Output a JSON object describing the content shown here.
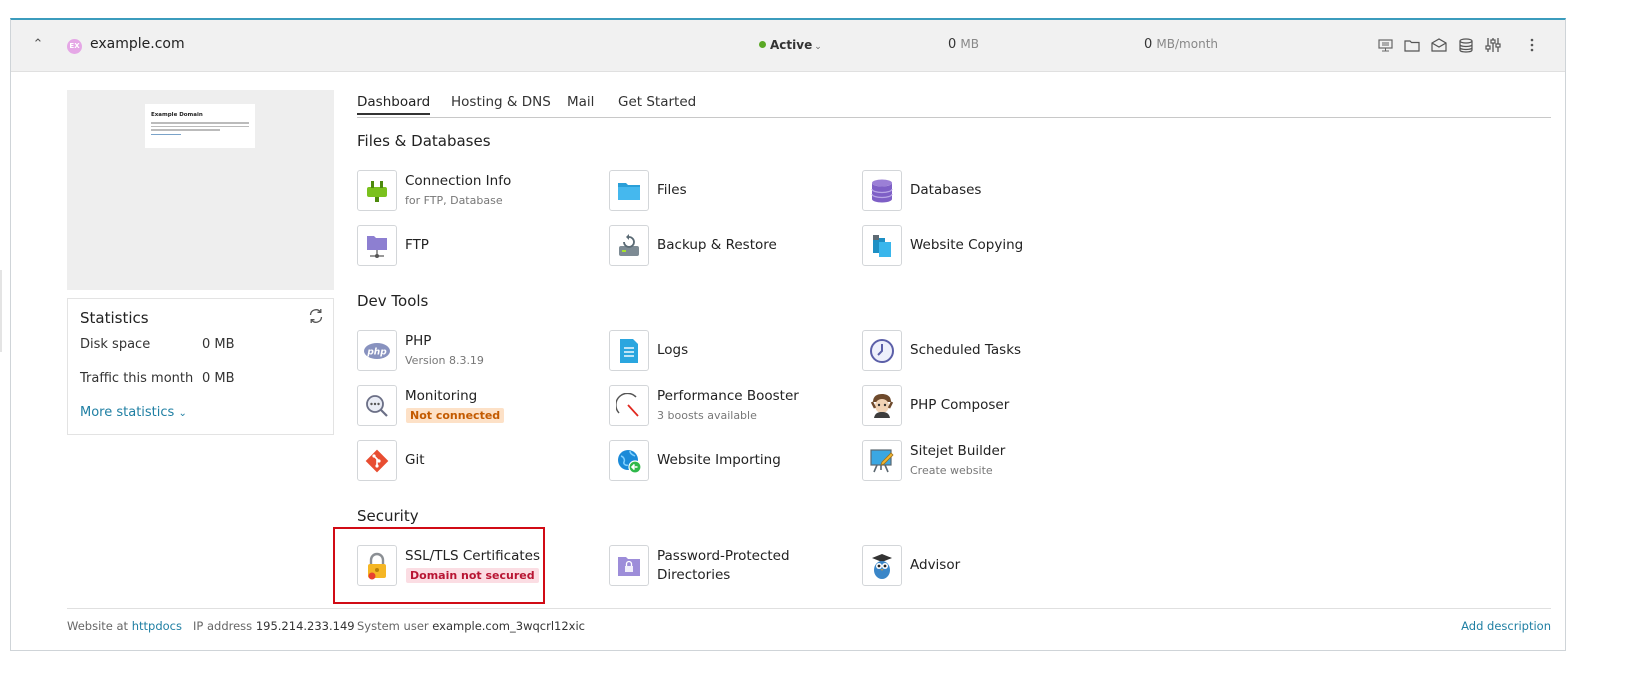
{
  "header": {
    "domain_favicon": "EX",
    "domain": "example.com",
    "status": "Active",
    "disk_value": "0",
    "disk_unit": "MB",
    "traffic_value": "0",
    "traffic_unit": "MB/month",
    "icons": [
      "monitor-icon",
      "folder-icon",
      "mail-icon",
      "database-icon",
      "settings-sliders-icon",
      "more-vertical-icon"
    ]
  },
  "preview": {
    "title": "Example Domain"
  },
  "stats": {
    "title": "Statistics",
    "disk_label": "Disk space",
    "disk_value": "0 MB",
    "traffic_label": "Traffic this month",
    "traffic_value": "0 MB",
    "more_label": "More statistics"
  },
  "tabs": [
    "Dashboard",
    "Hosting & DNS",
    "Mail",
    "Get Started"
  ],
  "sections": {
    "files": {
      "title": "Files & Databases",
      "tools": [
        {
          "name": "Connection Info",
          "sub": "for FTP, Database"
        },
        {
          "name": "Files"
        },
        {
          "name": "Databases"
        },
        {
          "name": "FTP"
        },
        {
          "name": "Backup & Restore"
        },
        {
          "name": "Website Copying"
        }
      ]
    },
    "dev": {
      "title": "Dev Tools",
      "tools": [
        {
          "name": "PHP",
          "sub": "Version 8.3.19"
        },
        {
          "name": "Logs"
        },
        {
          "name": "Scheduled Tasks"
        },
        {
          "name": "Monitoring",
          "badge": "Not connected"
        },
        {
          "name": "Performance Booster",
          "sub": "3 boosts available"
        },
        {
          "name": "PHP Composer"
        },
        {
          "name": "Git"
        },
        {
          "name": "Website Importing"
        },
        {
          "name": "Sitejet Builder",
          "sub": "Create website"
        }
      ]
    },
    "security": {
      "title": "Security",
      "tools": [
        {
          "name": "SSL/TLS Certificates",
          "badge": "Domain not secured"
        },
        {
          "name": "Password-Protected",
          "name2": "Directories"
        },
        {
          "name": "Advisor"
        }
      ]
    }
  },
  "footer": {
    "website_label": "Website at",
    "website_link": "httpdocs",
    "ip_label": "IP address",
    "ip_value": "195.214.233.149",
    "user_label": "System user",
    "user_value": "example.com_3wqcrl12xic",
    "add_description": "Add description"
  },
  "colors": {
    "accent": "#1f7fa3",
    "status_active": "#5aa825",
    "highlight": "#d10b15",
    "warn_bg": "#fde1c7",
    "error_bg": "#fbdde3"
  }
}
